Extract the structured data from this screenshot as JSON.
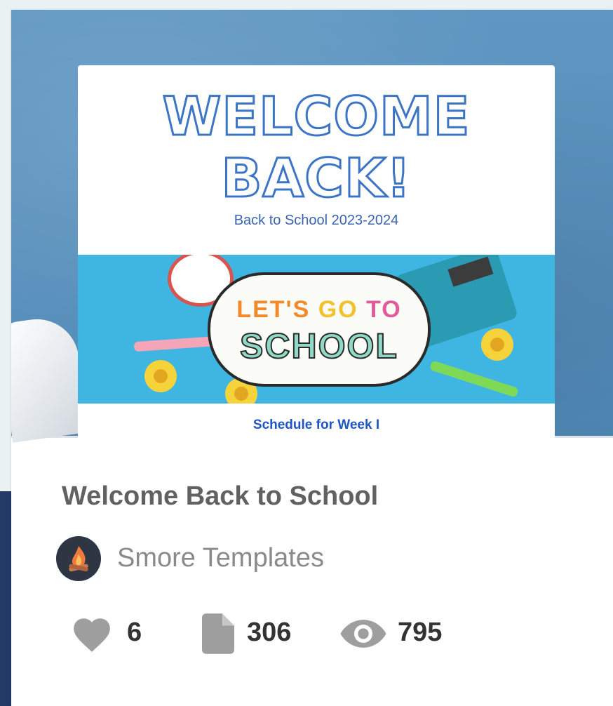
{
  "colors": {
    "accent_blue": "#3c74c6",
    "title_gray": "#616161",
    "author_gray": "#8a8a8a",
    "stat_dark": "#333333",
    "icon_gray": "#9e9e9e"
  },
  "preview": {
    "headline_line1": "WELCOME",
    "headline_line2": "BACK!",
    "subtitle": "Back to School 2023-2024",
    "banner_line1_word1": "LET'S",
    "banner_line1_word2": "GO",
    "banner_line1_word3": "TO",
    "banner_line2": "SCHOOL",
    "section_heading": "Schedule for Week I"
  },
  "card": {
    "title": "Welcome Back to School",
    "author": "Smore Templates",
    "avatar_icon": "campfire-icon",
    "stats": {
      "likes": "6",
      "likes_icon": "heart-icon",
      "pages": "306",
      "pages_icon": "document-icon",
      "views": "795",
      "views_icon": "eye-icon"
    }
  }
}
